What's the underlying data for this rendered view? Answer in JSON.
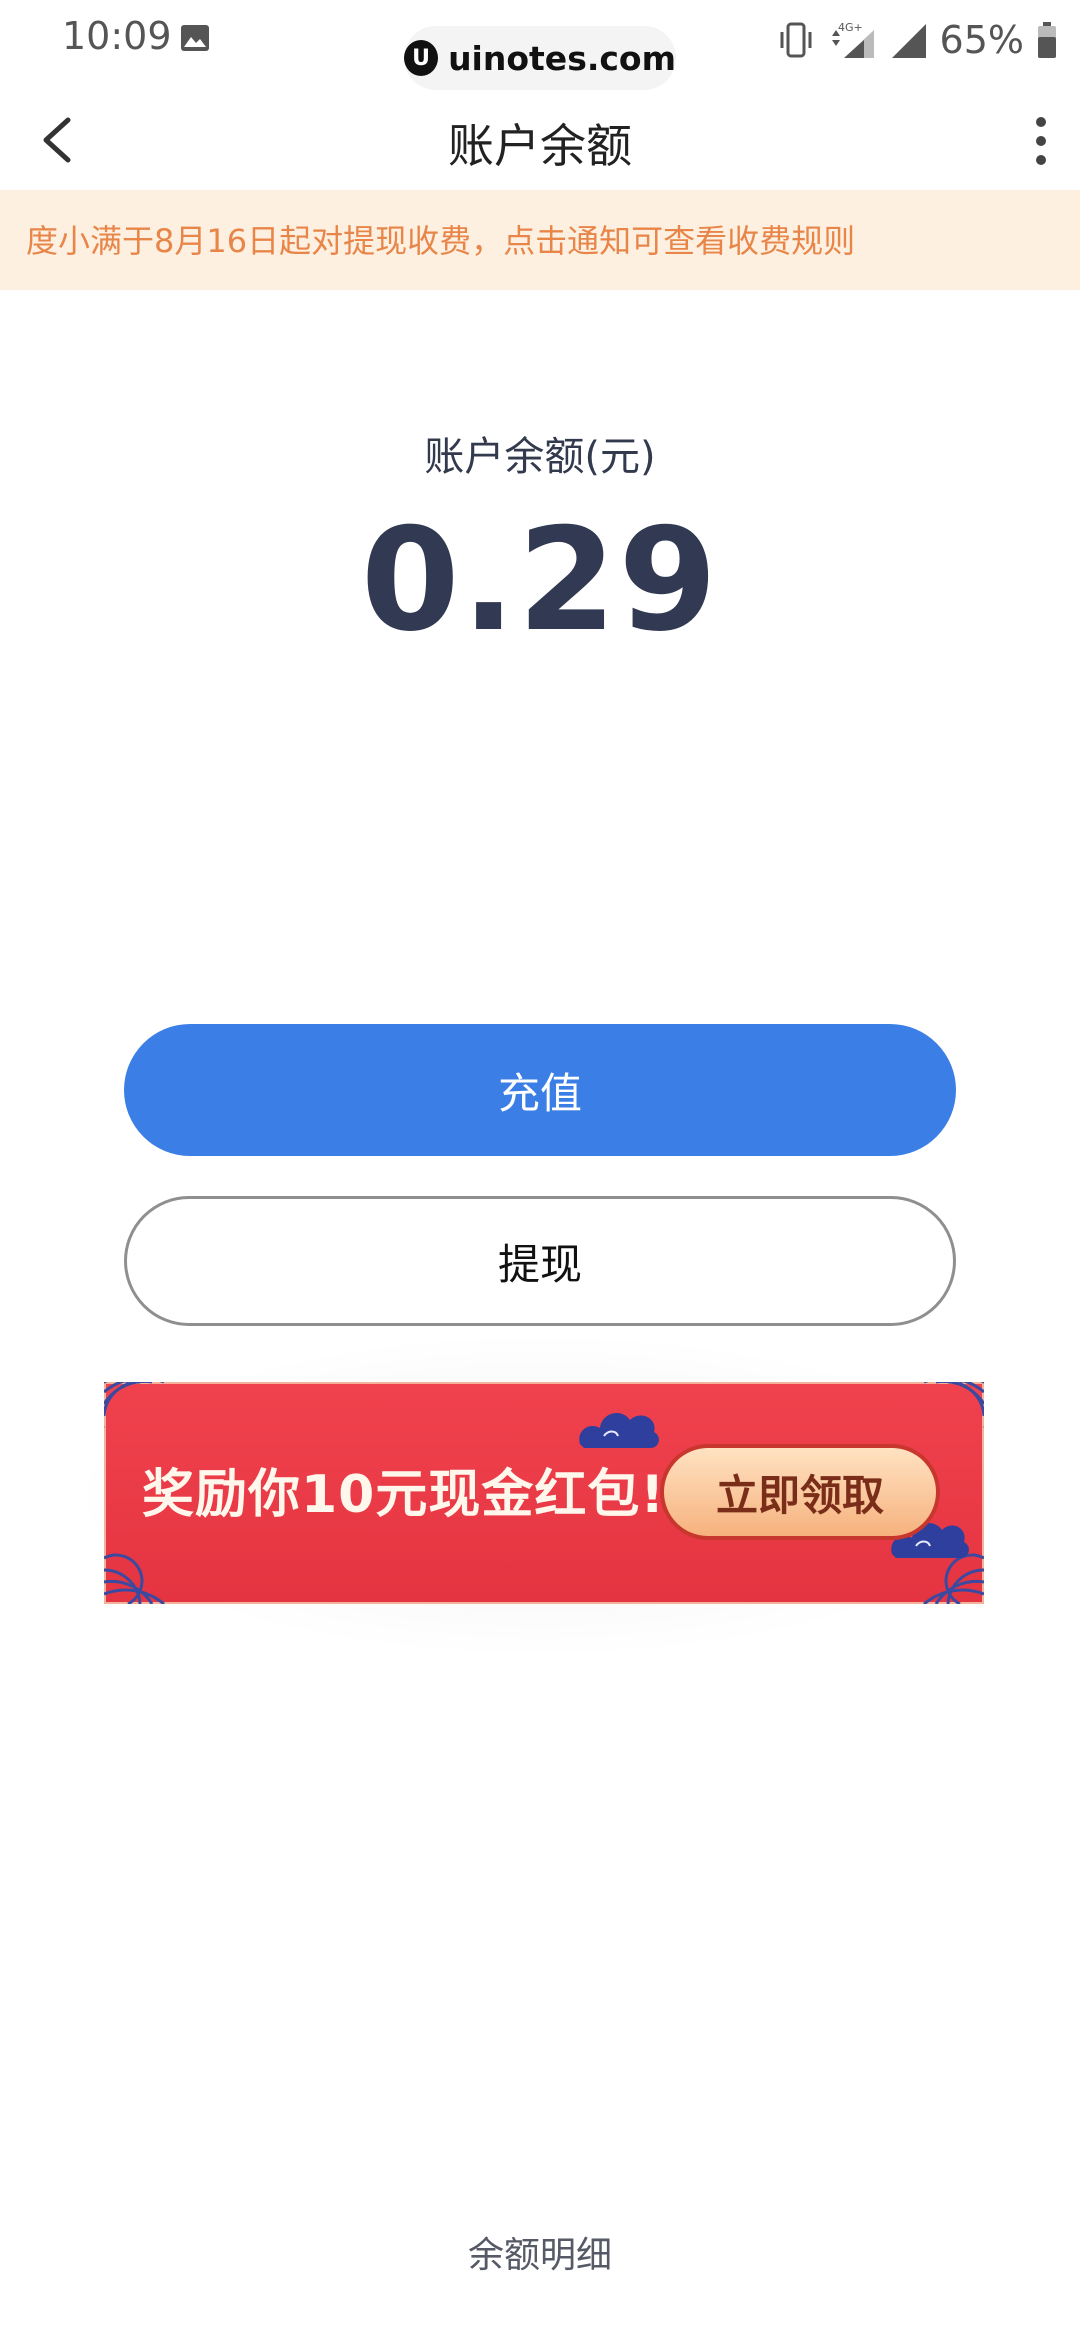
{
  "status_bar": {
    "time": "10:09",
    "battery_percent": "65%",
    "network": "4G+"
  },
  "watermark": {
    "logo": "U",
    "text": "uinotes.com"
  },
  "header": {
    "title": "账户余额"
  },
  "notice": {
    "text": "度小满于8月16日起对提现收费，点击通知可查看收费规则",
    "color": "#e8864a",
    "background": "#fdf0e0"
  },
  "balance": {
    "label": "账户余额(元)",
    "value": "0.29"
  },
  "actions": {
    "recharge_label": "充值",
    "withdraw_label": "提现",
    "accent_color": "#3b7fe6"
  },
  "promo": {
    "text": "奖励你10元现金红包!",
    "button_label": "立即领取",
    "background": "#e83a46"
  },
  "footer": {
    "detail_label": "余额明细"
  }
}
